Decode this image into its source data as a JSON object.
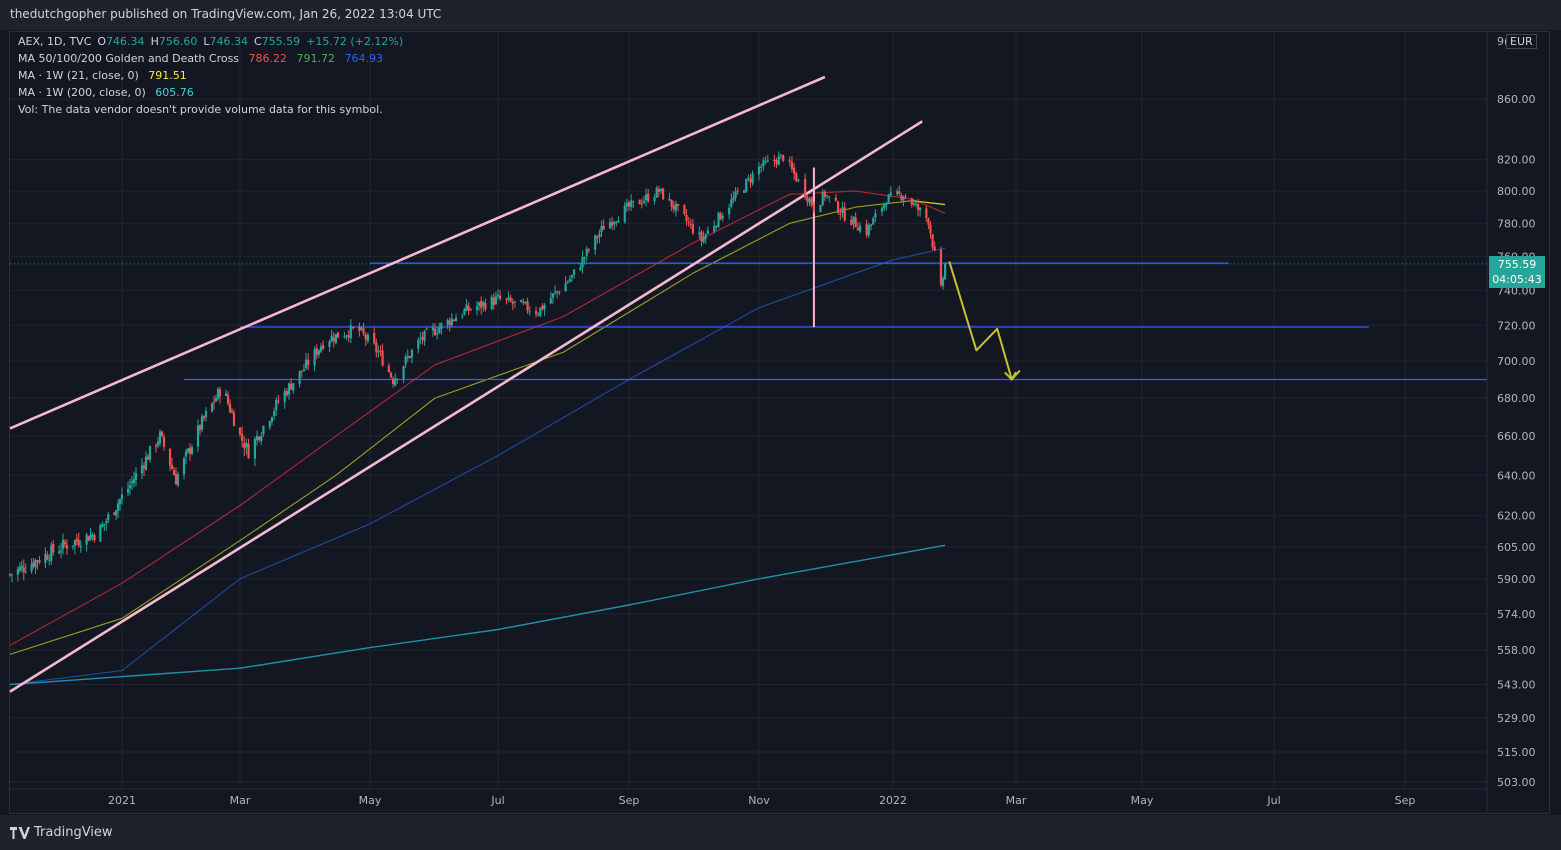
{
  "header": {
    "publisher_text": "thedutchgopher published on TradingView.com, Jan 26, 2022 13:04 UTC"
  },
  "legend": {
    "symbol": "AEX, 1D, TVC",
    "o_label": "O",
    "o_value": "746.34",
    "h_label": "H",
    "h_value": "756.60",
    "l_label": "L",
    "l_value": "746.34",
    "c_label": "C",
    "c_value": "755.59",
    "change": "+15.72 (+2.12%)",
    "ma_cross_label": "MA 50/100/200 Golden and Death Cross",
    "ma_cross_values": [
      "786.22",
      "791.72",
      "764.93"
    ],
    "ma21_label": "MA · 1W (21, close, 0)",
    "ma21_value": "791.51",
    "ma200_label": "MA · 1W (200, close, 0)",
    "ma200_value": "605.76",
    "vol_text": "Vol: The data vendor doesn't provide volume data for this symbol."
  },
  "price_axis": {
    "currency": "EUR",
    "top_partial": "9(",
    "current_price": "755.59",
    "countdown": "04:05:43"
  },
  "footer": {
    "brand": "TradingView"
  },
  "colors": {
    "bg": "#131722",
    "up": "#26a69a",
    "down": "#ef5350",
    "ma50": "#b22833",
    "ma100": "#9ba123",
    "ma200": "#1e4a9e",
    "ma21w": "#c8c82a",
    "ma200w": "#1e90a8",
    "channel": "#f6b8cf",
    "hline": "#2962ff",
    "projection": "#c9c232"
  },
  "chart_data": {
    "type": "candlestick",
    "title": "",
    "x_ticks": [
      "2021",
      "Mar",
      "May",
      "Jul",
      "Sep",
      "Nov",
      "2022",
      "Mar",
      "May",
      "Jul",
      "Sep"
    ],
    "x_range": [
      "2020-11-05",
      "2022-11-05"
    ],
    "y_ticks": [
      503,
      515,
      529,
      543,
      558,
      574,
      590,
      605,
      620,
      640,
      660,
      680,
      700,
      720,
      740,
      760,
      780,
      800,
      820,
      860
    ],
    "y_tick_labels": [
      "503.00",
      "515.00",
      "529.00",
      "543.00",
      "558.00",
      "574.00",
      "590.00",
      "605.00",
      "620.00",
      "640.00",
      "660.00",
      "680.00",
      "700.00",
      "720.00",
      "740.00",
      "760.00",
      "780.00",
      "800.00",
      "820.00",
      "860.00"
    ],
    "y_scale": "log",
    "grid": true,
    "close_path": [
      [
        "2020-11-05",
        592
      ],
      [
        "2020-12-01",
        605
      ],
      [
        "2020-12-20",
        612
      ],
      [
        "2021-01-05",
        635
      ],
      [
        "2021-01-20",
        660
      ],
      [
        "2021-01-28",
        638
      ],
      [
        "2021-02-10",
        667
      ],
      [
        "2021-02-20",
        686
      ],
      [
        "2021-03-01",
        660
      ],
      [
        "2021-03-05",
        652
      ],
      [
        "2021-03-20",
        680
      ],
      [
        "2021-03-31",
        696
      ],
      [
        "2021-04-10",
        712
      ],
      [
        "2021-04-25",
        718
      ],
      [
        "2021-05-05",
        705
      ],
      [
        "2021-05-12",
        690
      ],
      [
        "2021-05-25",
        712
      ],
      [
        "2021-06-15",
        728
      ],
      [
        "2021-07-01",
        735
      ],
      [
        "2021-07-20",
        728
      ],
      [
        "2021-08-05",
        748
      ],
      [
        "2021-08-20",
        778
      ],
      [
        "2021-09-01",
        790
      ],
      [
        "2021-09-15",
        800
      ],
      [
        "2021-09-25",
        786
      ],
      [
        "2021-10-05",
        770
      ],
      [
        "2021-10-20",
        795
      ],
      [
        "2021-11-01",
        815
      ],
      [
        "2021-11-12",
        822
      ],
      [
        "2021-11-26",
        790
      ],
      [
        "2021-12-01",
        798
      ],
      [
        "2021-12-10",
        785
      ],
      [
        "2021-12-20",
        775
      ],
      [
        "2021-12-29",
        795
      ],
      [
        "2022-01-06",
        798
      ],
      [
        "2022-01-12",
        790
      ],
      [
        "2022-01-18",
        782
      ],
      [
        "2022-01-24",
        740
      ],
      [
        "2022-01-26",
        755.59
      ]
    ],
    "last_candle": {
      "date": "2022-01-26",
      "open": 746.34,
      "high": 756.6,
      "low": 746.34,
      "close": 755.59
    },
    "series": [
      {
        "name": "MA 50",
        "color": "#b22833",
        "values": [
          [
            "2020-11-05",
            560
          ],
          [
            "2021-01-01",
            588
          ],
          [
            "2021-03-01",
            625
          ],
          [
            "2021-04-15",
            660
          ],
          [
            "2021-06-01",
            698
          ],
          [
            "2021-08-01",
            725
          ],
          [
            "2021-10-01",
            768
          ],
          [
            "2021-11-15",
            798
          ],
          [
            "2021-12-15",
            800
          ],
          [
            "2022-01-10",
            795
          ],
          [
            "2022-01-26",
            786.22
          ]
        ]
      },
      {
        "name": "MA 100",
        "color": "#9ba123",
        "values": [
          [
            "2020-11-05",
            556
          ],
          [
            "2021-01-01",
            572
          ],
          [
            "2021-03-01",
            608
          ],
          [
            "2021-04-15",
            640
          ],
          [
            "2021-06-01",
            680
          ],
          [
            "2021-08-01",
            705
          ],
          [
            "2021-10-01",
            750
          ],
          [
            "2021-11-15",
            780
          ],
          [
            "2021-12-15",
            790
          ],
          [
            "2022-01-10",
            794
          ],
          [
            "2022-01-26",
            791.72
          ]
        ]
      },
      {
        "name": "MA 200",
        "color": "#1e4a9e",
        "values": [
          [
            "2020-11-05",
            543
          ],
          [
            "2021-01-01",
            549
          ],
          [
            "2021-03-01",
            590
          ],
          [
            "2021-05-01",
            616
          ],
          [
            "2021-07-01",
            650
          ],
          [
            "2021-09-01",
            690
          ],
          [
            "2021-11-01",
            730
          ],
          [
            "2022-01-01",
            758
          ],
          [
            "2022-01-26",
            764.93
          ]
        ]
      },
      {
        "name": "MA · 1W (21)",
        "color": "#c8c82a",
        "values": [
          [
            "2022-01-10",
            794
          ],
          [
            "2022-01-26",
            791.51
          ]
        ]
      },
      {
        "name": "MA · 1W (200)",
        "color": "#1e90a8",
        "values": [
          [
            "2020-11-05",
            543
          ],
          [
            "2021-03-01",
            550
          ],
          [
            "2021-05-01",
            559
          ],
          [
            "2021-07-01",
            567
          ],
          [
            "2021-09-01",
            578
          ],
          [
            "2021-11-01",
            590
          ],
          [
            "2022-01-26",
            605.76
          ]
        ]
      }
    ],
    "annotations": {
      "channel_upper": [
        [
          "2020-11-05",
          664
        ],
        [
          "2021-12-01",
          875
        ]
      ],
      "channel_lower": [
        [
          "2020-11-05",
          540
        ],
        [
          "2022-01-15",
          845
        ]
      ],
      "horizontal_levels": [
        {
          "price": 756,
          "from": "2021-05-01",
          "to": "2022-06-10"
        },
        {
          "price": 719,
          "from": "2021-03-01",
          "to": "2022-08-15"
        },
        {
          "price": 690,
          "from": "2021-02-01",
          "to": "2022-11-05"
        }
      ],
      "vertical_marker": {
        "date": "2021-11-26",
        "from": 719,
        "to": 815
      },
      "projection_path": [
        [
          "2022-01-28",
          757
        ],
        [
          "2022-02-10",
          706
        ],
        [
          "2022-02-20",
          718
        ],
        [
          "2022-02-27",
          690
        ],
        [
          "2022-03-01",
          694
        ]
      ]
    }
  }
}
